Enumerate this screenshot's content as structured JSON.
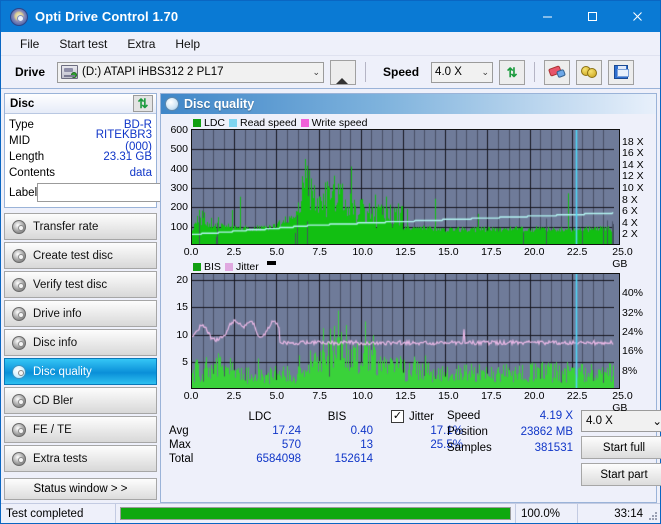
{
  "window": {
    "title": "Opti Drive Control 1.70",
    "icon": "disc-icon",
    "minimize": "minimize-icon",
    "maximize": "maximize-icon",
    "close": "close-icon"
  },
  "menu": {
    "items": [
      "File",
      "Start test",
      "Extra",
      "Help"
    ]
  },
  "toolbar": {
    "drive_label": "Drive",
    "drive_value": "(D:)  ATAPI iHBS312  2 PL17",
    "eject_icon": "eject-icon",
    "speed_label": "Speed",
    "speed_value": "4.0 X",
    "refresh_icon": "refresh-icon",
    "erase_icon": "eraser-icon",
    "settings_icon": "gold-tool-icon",
    "save_icon": "floppy-save-icon",
    "caret": "⌄"
  },
  "disc": {
    "title": "Disc",
    "refresh_icon": "refresh-icon",
    "rows": [
      {
        "key": "Type",
        "value": "BD-R"
      },
      {
        "key": "MID",
        "value": "RITEKBR3 (000)"
      },
      {
        "key": "Length",
        "value": "23.31 GB"
      },
      {
        "key": "Contents",
        "value": "data"
      }
    ],
    "label_key": "Label",
    "label_value": "",
    "label_placeholder": "",
    "cd_icon": "cd-disc-icon"
  },
  "nav": {
    "items": [
      {
        "label": "Transfer rate",
        "active": false
      },
      {
        "label": "Create test disc",
        "active": false
      },
      {
        "label": "Verify test disc",
        "active": false
      },
      {
        "label": "Drive info",
        "active": false
      },
      {
        "label": "Disc info",
        "active": false
      },
      {
        "label": "Disc quality",
        "active": true
      },
      {
        "label": "CD Bler",
        "active": false
      },
      {
        "label": "FE / TE",
        "active": false
      },
      {
        "label": "Extra tests",
        "active": false
      }
    ],
    "status_button": "Status window > >"
  },
  "main": {
    "title": "Disc quality",
    "icon": "disc-quality-icon"
  },
  "chart_data": [
    {
      "type": "area",
      "title": "LDC / Read speed",
      "legend": [
        {
          "name": "LDC",
          "color": "#12a012"
        },
        {
          "name": "Read speed",
          "color": "#7fd4f0"
        },
        {
          "name": "Write speed",
          "color": "#f060d8"
        }
      ],
      "xlabel": "",
      "ylabel": "",
      "x_unit": "25.0 GB",
      "xticks": [
        "0.0",
        "2.5",
        "5.0",
        "7.5",
        "10.0",
        "12.5",
        "15.0",
        "17.5",
        "20.0",
        "22.5",
        "25.0 GB"
      ],
      "xlim": [
        0,
        25
      ],
      "ylim": [
        0,
        600
      ],
      "yticks": [
        100,
        200,
        300,
        400,
        500,
        600
      ],
      "right_ylim": [
        0,
        18
      ],
      "right_yticks": [
        "2 X",
        "4 X",
        "6 X",
        "8 X",
        "10 X",
        "12 X",
        "14 X",
        "16 X",
        "18 X"
      ],
      "grid": true,
      "marker_x": 22.75,
      "series": [
        {
          "name": "LDC",
          "color": "#12a012",
          "type": "impulse",
          "baseline": [
            95,
            150,
            130,
            120,
            115,
            110,
            105,
            100,
            98,
            96,
            95,
            94,
            93,
            92,
            92,
            93,
            95,
            100,
            110,
            125,
            140,
            160,
            185,
            210,
            200,
            175,
            160,
            150,
            145,
            150,
            160,
            150,
            140,
            130,
            120,
            112,
            108,
            104,
            100,
            98,
            96,
            95,
            94,
            93,
            92,
            91,
            90,
            90,
            90,
            90,
            88,
            87,
            86,
            86,
            86,
            85,
            85,
            85,
            85,
            85,
            86,
            86,
            87,
            88,
            88,
            88,
            88,
            88,
            88,
            88,
            88,
            88,
            88,
            88,
            88,
            88,
            88,
            88,
            88,
            88,
            88,
            88,
            88,
            88,
            88,
            88,
            88,
            88,
            88,
            88
          ]
        },
        {
          "name": "ReadSpeed",
          "color": "#aef2f2",
          "type": "line",
          "values": [
            60,
            62,
            63,
            65,
            66,
            68,
            70,
            72,
            74,
            76,
            78,
            80,
            82,
            84,
            85,
            86,
            88,
            90,
            92,
            94,
            96,
            98,
            100,
            102,
            104,
            106,
            108,
            110,
            110,
            111,
            112,
            113,
            114,
            115,
            116,
            117,
            118,
            119,
            120,
            121,
            122,
            123,
            124,
            125,
            126,
            127,
            128,
            129,
            130,
            131,
            132,
            133,
            134,
            135,
            136,
            137,
            138,
            139,
            140,
            141,
            142,
            143,
            144,
            145,
            146,
            147,
            148,
            149,
            150,
            151,
            152,
            153,
            154,
            155,
            156,
            157,
            158,
            159,
            160,
            161,
            162,
            163,
            164,
            165,
            166,
            167,
            168,
            169,
            170,
            171
          ]
        }
      ]
    },
    {
      "type": "area",
      "title": "BIS / Jitter",
      "legend": [
        {
          "name": "BIS",
          "color": "#12a012"
        },
        {
          "name": "Jitter",
          "color": "#e0a8e0"
        }
      ],
      "xlabel": "",
      "ylabel": "",
      "x_unit": "25.0 GB",
      "xticks": [
        "0.0",
        "2.5",
        "5.0",
        "7.5",
        "10.0",
        "12.5",
        "15.0",
        "17.5",
        "20.0",
        "22.5",
        "25.0 GB"
      ],
      "xlim": [
        0,
        25
      ],
      "ylim": [
        0,
        21
      ],
      "yticks": [
        5,
        10,
        15,
        20
      ],
      "right_ylim": [
        0,
        42
      ],
      "right_yticks": [
        "8%",
        "16%",
        "24%",
        "32%",
        "40%"
      ],
      "grid": true,
      "marker_x": 22.75,
      "series": [
        {
          "name": "BIS",
          "color": "#3cc83c",
          "type": "impulse"
        },
        {
          "name": "Jitter",
          "color": "#e8b4e0",
          "type": "line",
          "values_pct": [
            19,
            21,
            24,
            22,
            19,
            18,
            19,
            20,
            24,
            25,
            24,
            23,
            25,
            24,
            20,
            19,
            22,
            25,
            24,
            19,
            17.5,
            17,
            17.2,
            17,
            17.3,
            17,
            17.2,
            17.1,
            17,
            17.2,
            17,
            17.1,
            17,
            17.2,
            17.1,
            17,
            17.2,
            17,
            17.1,
            17,
            17.1,
            17,
            17.2,
            17.1,
            17,
            17.2,
            17,
            20,
            17.2,
            17,
            17.1,
            17,
            17.2,
            17,
            17.1,
            17,
            17.2,
            17,
            17.1,
            17,
            17.2,
            17,
            17.1,
            17.3,
            17,
            17.2,
            17,
            17.1,
            17,
            17.2,
            17,
            17.1,
            17.2,
            17,
            17.1,
            17,
            17.2,
            17,
            17.1,
            17,
            17.2,
            17,
            17.1,
            17,
            17.2,
            17.3,
            17,
            17.1,
            17,
            17
          ]
        }
      ]
    }
  ],
  "stats": {
    "col_headers": [
      "LDC",
      "BIS"
    ],
    "jitter_label": "Jitter",
    "jitter_checked": true,
    "jitter_check_glyph": "✓",
    "rows": [
      {
        "key": "Avg",
        "ldc": "17.24",
        "bis": "0.40",
        "jitter": "17.1%"
      },
      {
        "key": "Max",
        "ldc": "570",
        "bis": "13",
        "jitter": "25.5%"
      },
      {
        "key": "Total",
        "ldc": "6584098",
        "bis": "152614",
        "jitter": ""
      }
    ]
  },
  "readout": {
    "rows": [
      {
        "key": "Speed",
        "value": "4.19 X"
      },
      {
        "key": "Position",
        "value": "23862 MB"
      },
      {
        "key": "Samples",
        "value": "381531"
      }
    ],
    "speed_select": "4.0 X",
    "caret": "⌄",
    "start_full": "Start full",
    "start_part": "Start part"
  },
  "statusbar": {
    "text": "Test completed",
    "percent": "100.0%",
    "progress": 100,
    "time": "33:14"
  }
}
